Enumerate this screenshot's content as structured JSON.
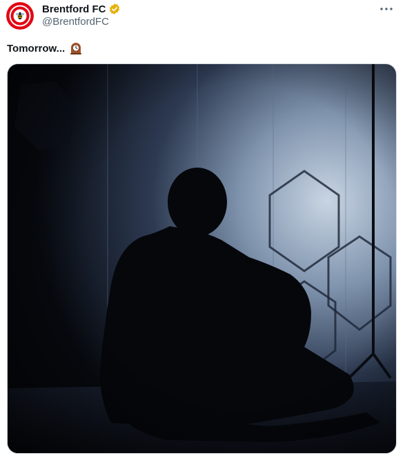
{
  "tweet": {
    "author": {
      "display_name": "Brentford FC",
      "handle": "@BrentfordFC",
      "verified": true,
      "verified_badge_color": "#e8b00c",
      "avatar_icon": "brentford-crest-icon"
    },
    "text": "Tomorrow...",
    "emoji_icon": "mantelpiece-clock-emoji",
    "more_icon": "more-options-icon",
    "media": {
      "type": "video-still",
      "description_icon": "silhouette-figure-image"
    }
  },
  "colors": {
    "brand_red": "#e30613",
    "text_primary": "#0f1419",
    "text_secondary": "#536471",
    "media_dark": "#0b0f17",
    "media_light": "#b9c7d6"
  }
}
